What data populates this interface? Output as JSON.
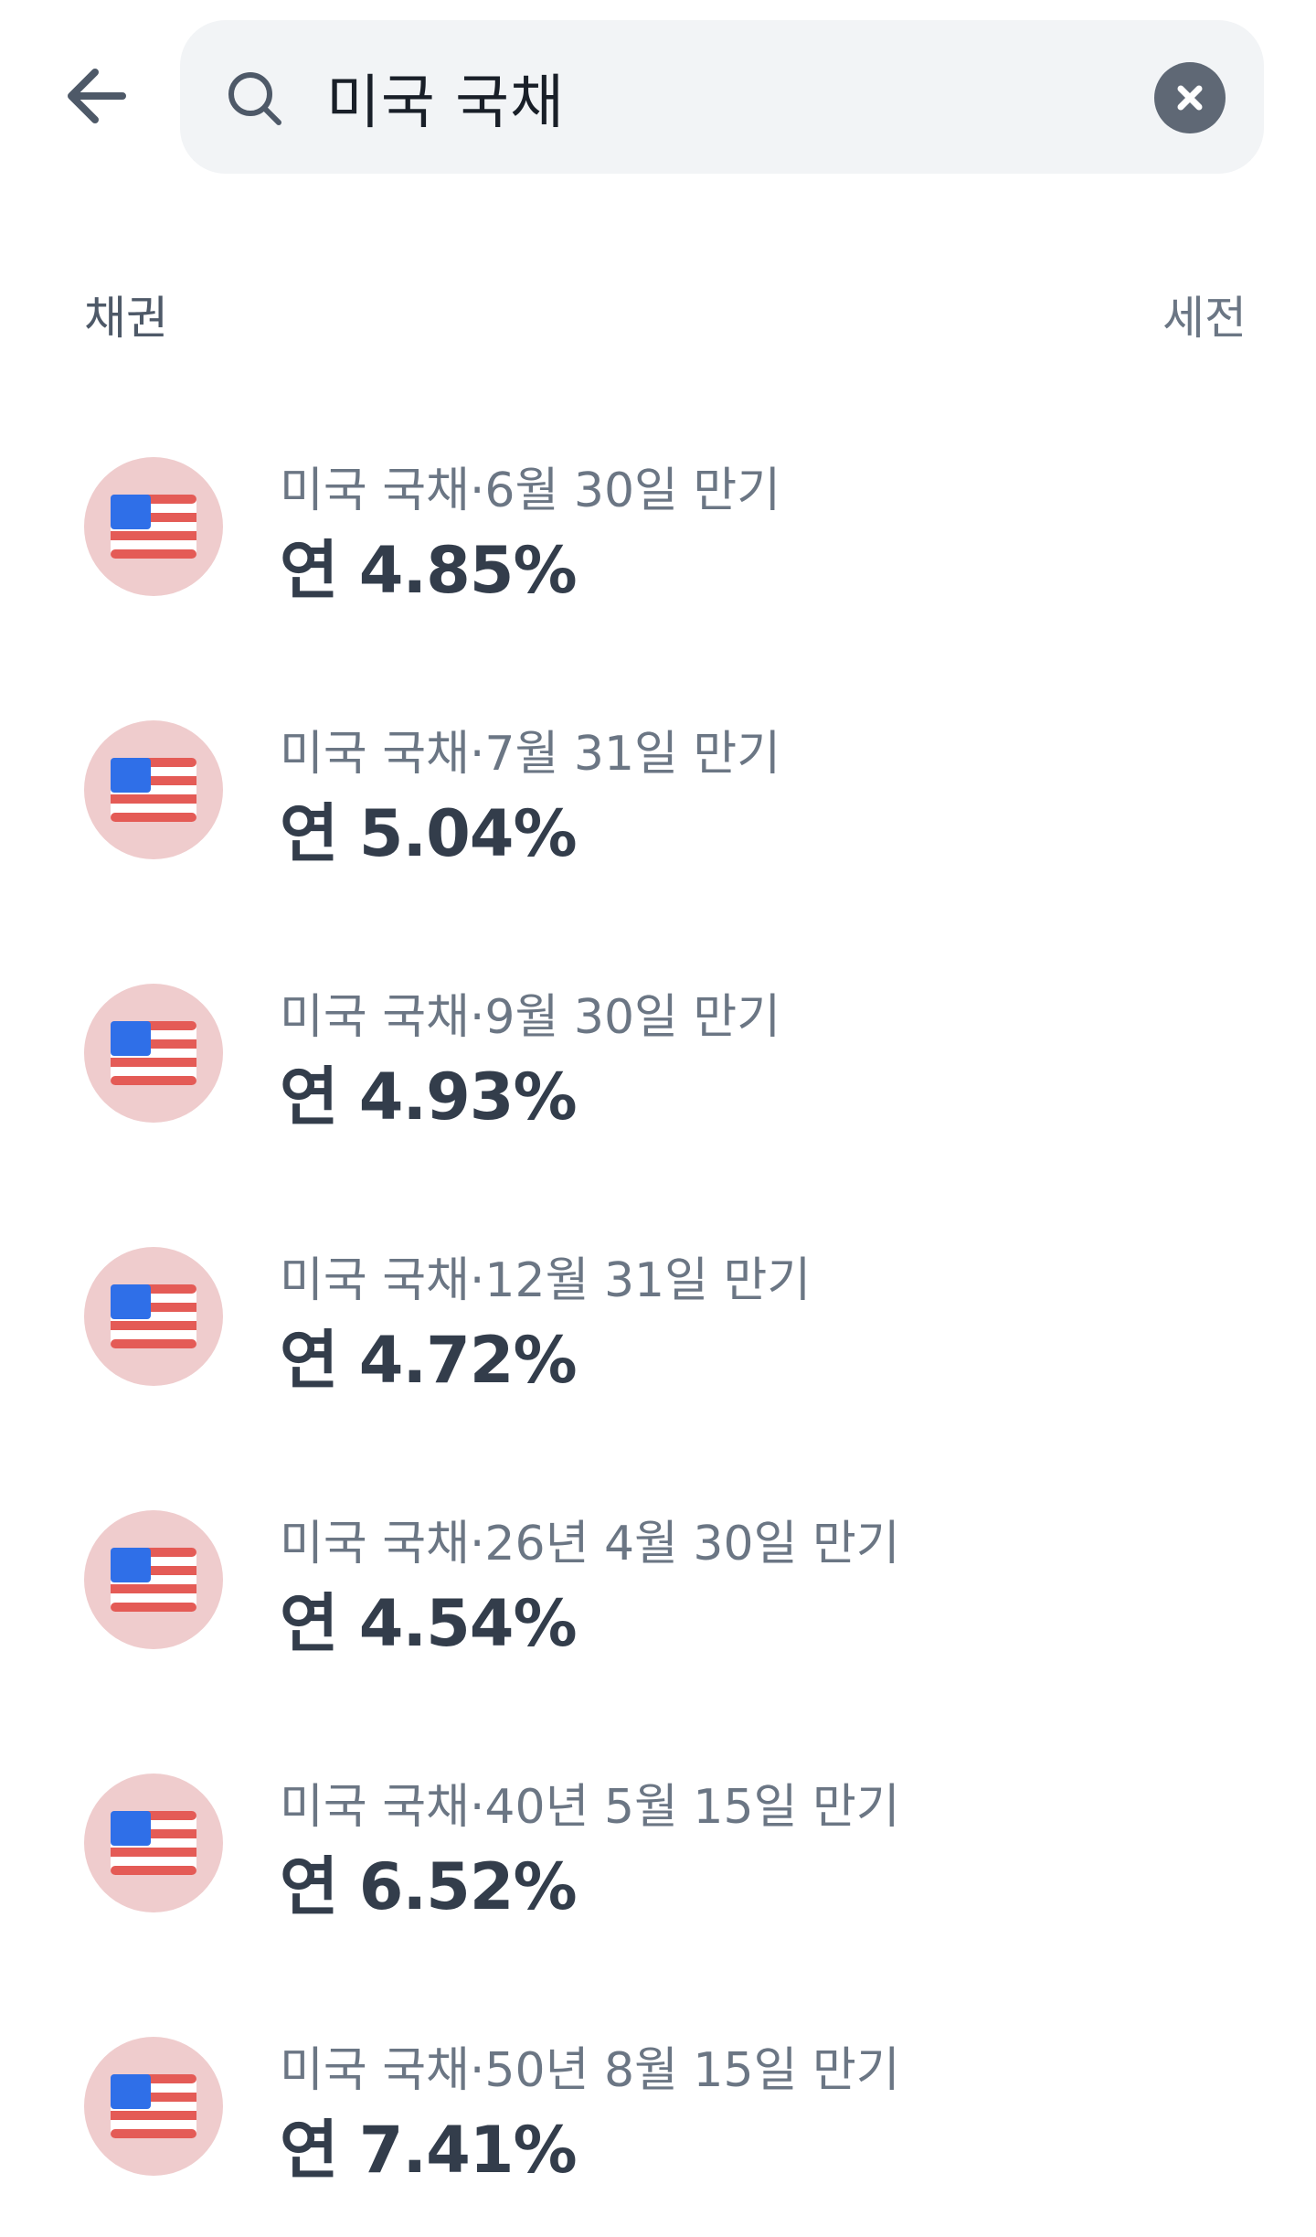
{
  "search": {
    "value": "미국 국채",
    "back_icon": "arrow-left-icon",
    "search_icon": "search-icon",
    "clear_icon": "close-circle-icon"
  },
  "section": {
    "title": "채권",
    "action": "세전"
  },
  "colors": {
    "flag_blue": "#2f6fe8",
    "flag_red": "#e45b56",
    "avatar_bg": "#efcccd",
    "rate_text": "#333d4b",
    "name_text": "#6b7684",
    "search_bg": "#f2f4f6"
  },
  "bonds": [
    {
      "name": "미국 국채·6월 30일 만기",
      "rate": "연 4.85%",
      "icon": "us-flag-icon"
    },
    {
      "name": "미국 국채·7월 31일 만기",
      "rate": "연 5.04%",
      "icon": "us-flag-icon"
    },
    {
      "name": "미국 국채·9월 30일 만기",
      "rate": "연 4.93%",
      "icon": "us-flag-icon"
    },
    {
      "name": "미국 국채·12월 31일 만기",
      "rate": "연 4.72%",
      "icon": "us-flag-icon"
    },
    {
      "name": "미국 국채·26년 4월 30일 만기",
      "rate": "연 4.54%",
      "icon": "us-flag-icon"
    },
    {
      "name": "미국 국채·40년 5월 15일 만기",
      "rate": "연 6.52%",
      "icon": "us-flag-icon"
    },
    {
      "name": "미국 국채·50년 8월 15일 만기",
      "rate": "연 7.41%",
      "icon": "us-flag-icon"
    }
  ]
}
